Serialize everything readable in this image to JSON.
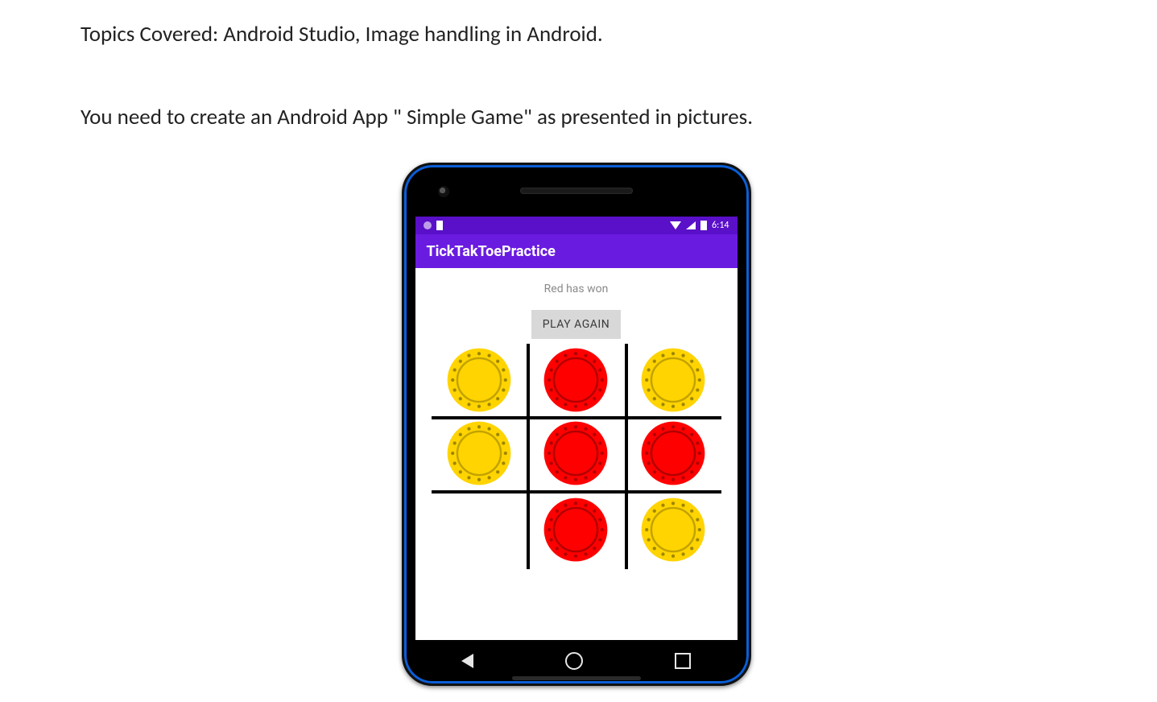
{
  "document": {
    "topics_line": "Topics Covered: Android Studio, Image handling in Android.",
    "instruction_line": "You need to create an Android App \" Simple Game\" as presented in pictures."
  },
  "phone": {
    "status_bar": {
      "time": "6:14"
    },
    "app_title": "TickTakToePractice",
    "game": {
      "status_text": "Red has won",
      "play_again_label": "PLAY AGAIN",
      "board": [
        [
          "yellow",
          "red",
          "yellow"
        ],
        [
          "yellow",
          "red",
          "red"
        ],
        [
          "empty",
          "red",
          "yellow"
        ]
      ],
      "colors": {
        "red": {
          "fill": "#ff0000",
          "rim": "#b00000",
          "dot": "#b00000"
        },
        "yellow": {
          "fill": "#ffd400",
          "rim": "#c2a200",
          "dot": "#9e8600"
        }
      }
    }
  }
}
